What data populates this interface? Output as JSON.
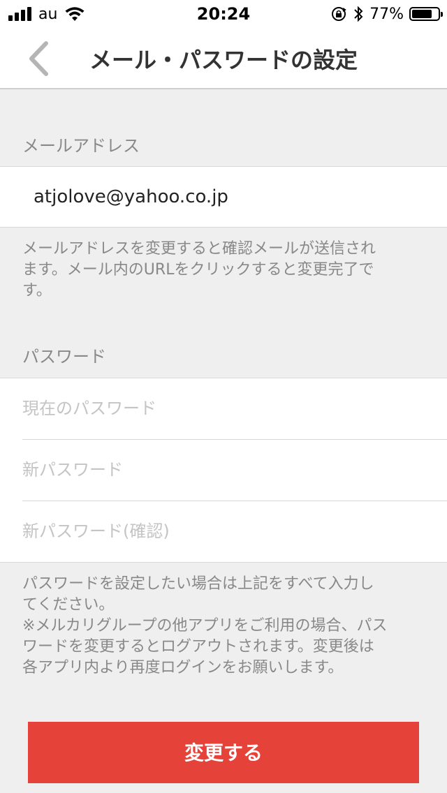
{
  "status_bar": {
    "carrier": "au",
    "time": "20:24",
    "battery_percent": "77%",
    "battery_level": 0.77,
    "icons": [
      "signal-icon",
      "wifi-icon",
      "orientation-lock-icon",
      "bluetooth-icon",
      "battery-icon"
    ]
  },
  "nav": {
    "title": "メール・パスワードの設定",
    "back_icon": "chevron-left-icon"
  },
  "email_section": {
    "label": "メールアドレス",
    "value": "atjolove@yahoo.co.jp",
    "note_line1": "メールアドレスを変更すると確認メールが送信され",
    "note_line2": "ます。メール内のURLをクリックすると変更完了で",
    "note_line3": "す。"
  },
  "password_section": {
    "label": "パスワード",
    "current_placeholder": "現在のパスワード",
    "new_placeholder": "新パスワード",
    "confirm_placeholder": "新パスワード(確認)",
    "note_line1": "パスワードを設定したい場合は上記をすべて入力し",
    "note_line2": "てください。",
    "note_line3": "※メルカリグループの他アプリをご利用の場合、パス",
    "note_line4": "ワードを変更するとログアウトされます。変更後は",
    "note_line5": "各アプリ内より再度ログインをお願いします。"
  },
  "submit": {
    "label": "変更する",
    "color": "#e5433a"
  }
}
